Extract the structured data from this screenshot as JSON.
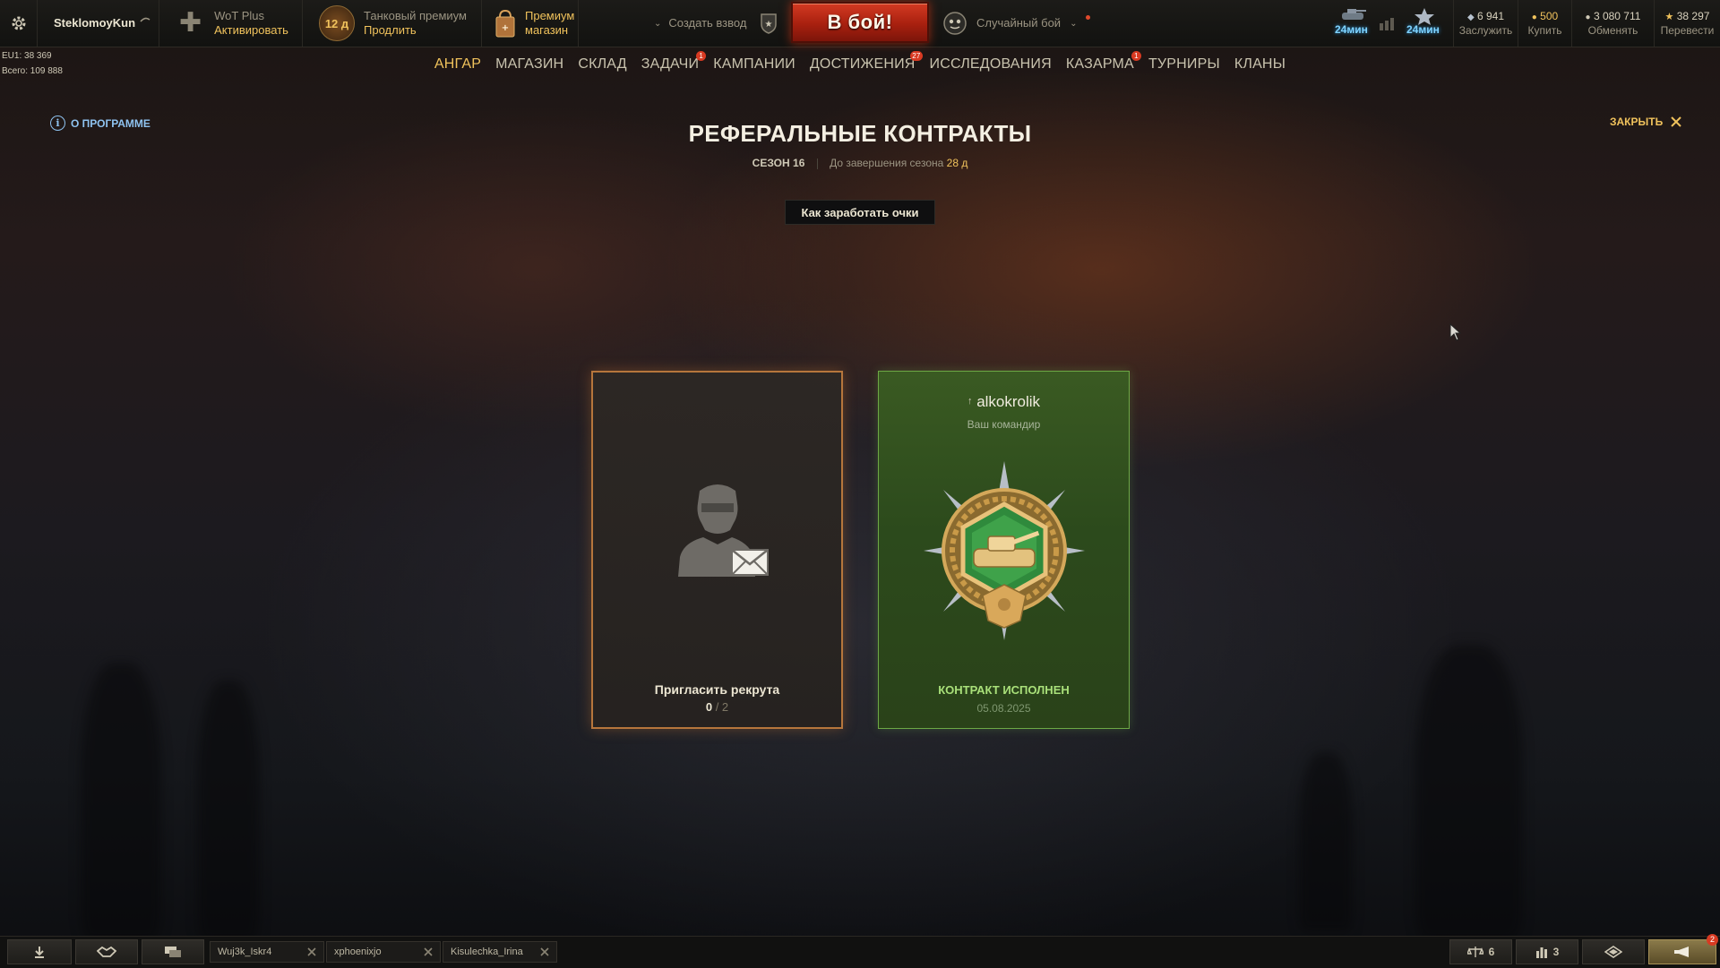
{
  "topbar": {
    "username": "SteklomoyKun",
    "wotplus_title": "WoT Plus",
    "wotplus_action": "Активировать",
    "premium_days": "12 д",
    "premium_title": "Танковый премиум",
    "premium_action": "Продлить",
    "shop_title": "Премиум",
    "shop_title2": "магазин",
    "platoon_label": "Создать взвод",
    "battle_label": "В бой!",
    "battle_mode": "Случайный бой",
    "timer1": "24мин",
    "timer2": "24мин",
    "currencies": [
      {
        "value": "6 941",
        "action": "Заслужить",
        "icon": "bond-icon"
      },
      {
        "value": "500",
        "action": "Купить",
        "icon": "gold-icon"
      },
      {
        "value": "3 080 711",
        "action": "Обменять",
        "icon": "credits-icon"
      },
      {
        "value": "38 297",
        "action": "Перевести",
        "icon": "free-xp-icon"
      }
    ]
  },
  "server": {
    "line1": "EU1: 38 369",
    "line2": "Всего: 109 888"
  },
  "nav": {
    "items": [
      {
        "label": "АНГАР",
        "badge": ""
      },
      {
        "label": "МАГАЗИН",
        "badge": ""
      },
      {
        "label": "СКЛАД",
        "badge": ""
      },
      {
        "label": "ЗАДАЧИ",
        "badge": "1"
      },
      {
        "label": "КАМПАНИИ",
        "badge": ""
      },
      {
        "label": "ДОСТИЖЕНИЯ",
        "badge": "27"
      },
      {
        "label": "ИССЛЕДОВАНИЯ",
        "badge": ""
      },
      {
        "label": "КАЗАРМА",
        "badge": "1"
      },
      {
        "label": "ТУРНИРЫ",
        "badge": ""
      },
      {
        "label": "КЛАНЫ",
        "badge": ""
      }
    ],
    "active": "АНГАР"
  },
  "page": {
    "about_label": "О ПРОГРАММЕ",
    "close_label": "ЗАКРЫТЬ",
    "title": "РЕФЕРАЛЬНЫЕ КОНТРАКТЫ",
    "season": "СЕЗОН 16",
    "season_remaining_prefix": "До завершения сезона",
    "season_remaining_value": "28 д",
    "howto_button": "Как заработать очки"
  },
  "cards": {
    "invite": {
      "label": "Пригласить рекрута",
      "current": "0",
      "total": "/ 2"
    },
    "contract": {
      "commander_name": "alkokrolik",
      "commander_sub": "Ваш командир",
      "status": "КОНТРАКТ ИСПОЛНЕН",
      "date": "05.08.2025"
    }
  },
  "bottombar": {
    "chat_tabs": [
      "Wuj3k_Iskr4",
      "xphoenixjo",
      "Kisulechka_Irina"
    ],
    "counter1": "6",
    "counter2": "3",
    "notification_badge": "2"
  }
}
